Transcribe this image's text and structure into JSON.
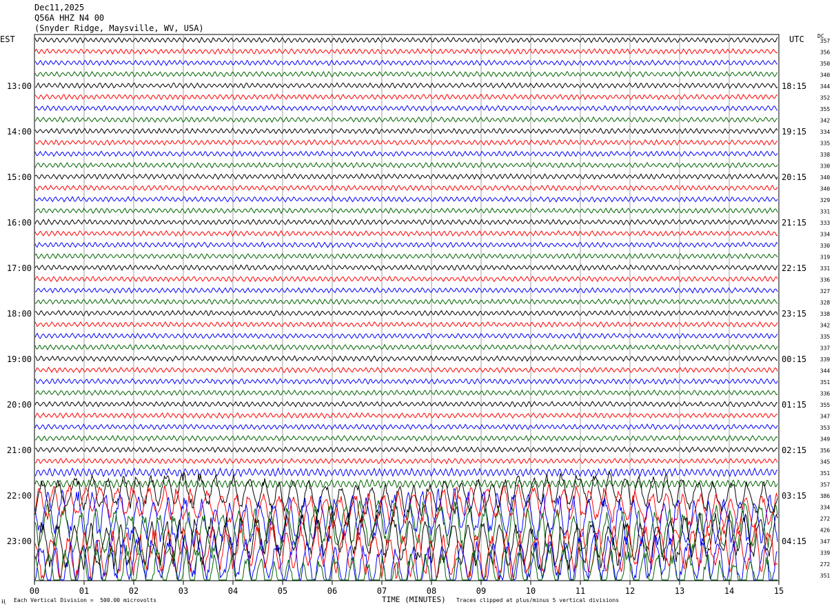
{
  "header": {
    "date": "Dec11,2025",
    "station": "Q56A HHZ N4 00",
    "location": "(Snyder Ridge, Maysville, WV, USA)"
  },
  "left_zone_label": "EST",
  "right_zone_label": "UTC",
  "dc_label": "DC",
  "footer": {
    "scale_note": "Each Vertical Division =  500.00 microvolts",
    "clip_note": "Traces clipped at plus/minus 5 vertical divisions",
    "scale_glyph": "Ⱨ"
  },
  "chart_data": {
    "type": "line",
    "title": "",
    "xlabel": "TIME (MINUTES)",
    "ylabel": "",
    "xlim": [
      0,
      15
    ],
    "x_ticks": [
      "00",
      "01",
      "02",
      "03",
      "04",
      "05",
      "06",
      "07",
      "08",
      "09",
      "10",
      "11",
      "12",
      "13",
      "14",
      "15"
    ],
    "trace_colors": [
      "#000000",
      "#ff0000",
      "#0000ff",
      "#006400"
    ],
    "left_hour_labels": [
      "13:00",
      "14:00",
      "15:00",
      "16:00",
      "17:00",
      "18:00",
      "19:00",
      "20:00",
      "21:00",
      "22:00",
      "23:00"
    ],
    "right_hour_labels": [
      "18:15",
      "19:15",
      "20:15",
      "21:15",
      "22:15",
      "23:15",
      "00:15",
      "01:15",
      "02:15",
      "03:15",
      "04:15"
    ],
    "dc_offsets": [
      357,
      356,
      350,
      340,
      344,
      352,
      355,
      342,
      334,
      335,
      338,
      330,
      340,
      340,
      329,
      331,
      333,
      334,
      330,
      319,
      331,
      336,
      327,
      328,
      338,
      342,
      335,
      337,
      339,
      344,
      351,
      336,
      355,
      347,
      353,
      349,
      356,
      345,
      351,
      357,
      386,
      334,
      272,
      426,
      347,
      339,
      272,
      351
    ],
    "trace_count": 48,
    "vertical_division_microvolts": 500.0,
    "clip_divisions": 5
  }
}
